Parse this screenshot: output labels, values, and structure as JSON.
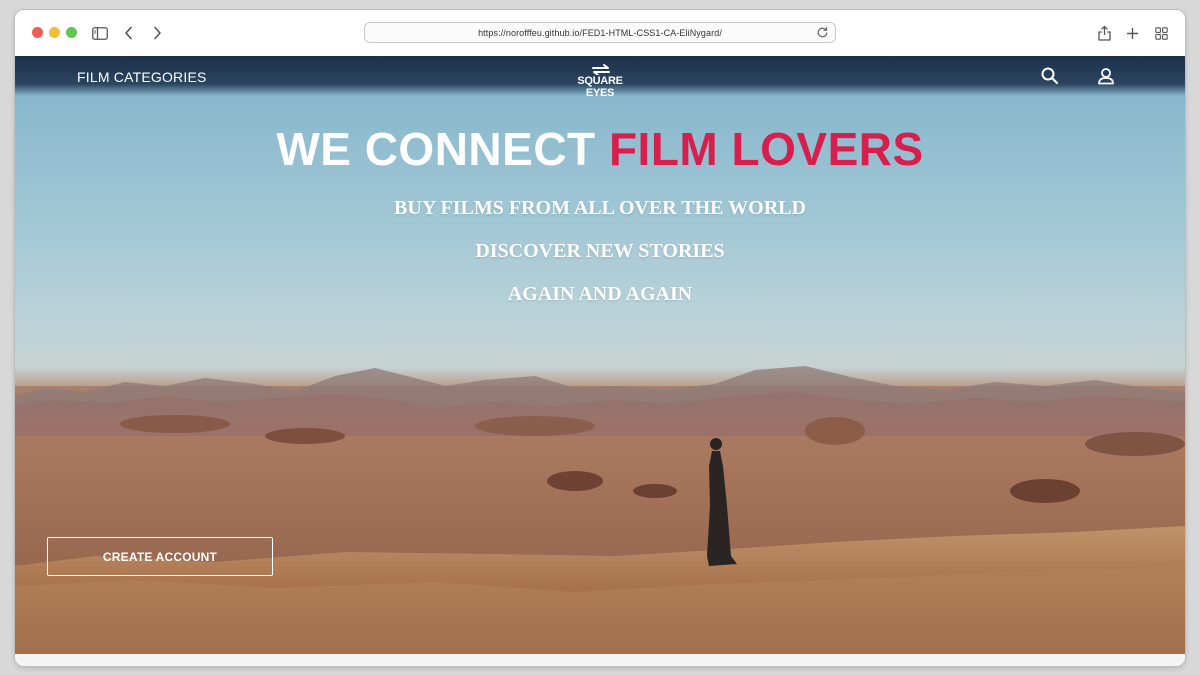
{
  "browser": {
    "url": "https://norofffeu.github.io/FED1-HTML-CSS1-CA-EliNygard/",
    "icons": [
      "sidebar-icon",
      "back-icon",
      "forward-icon",
      "reload-icon",
      "share-icon",
      "new-tab-icon",
      "tab-overview-icon"
    ]
  },
  "site": {
    "nav": {
      "categories_label": "FILM CATEGORIES",
      "logo_text": "SQUARE EYES",
      "icons": [
        "search-icon",
        "user-icon"
      ]
    },
    "hero": {
      "title_main": "WE CONNECT ",
      "title_accent": "FILM LOVERS",
      "taglines": [
        "BUY FILMS FROM ALL OVER THE WORLD",
        "DISCOVER NEW STORIES",
        "AGAIN AND AGAIN"
      ],
      "cta_label": "CREATE ACCOUNT"
    }
  },
  "colors": {
    "accent": "#d81e4c",
    "nav_bg": "#1d3049",
    "text_light": "#ffffff"
  }
}
